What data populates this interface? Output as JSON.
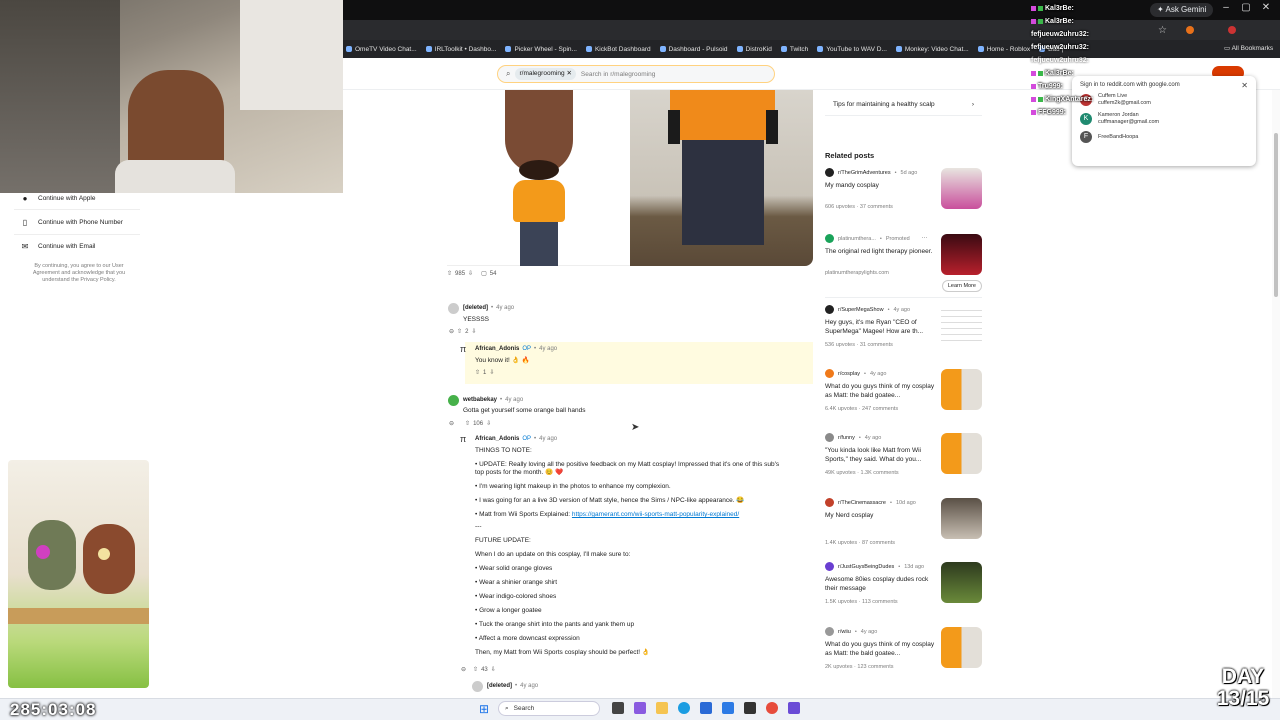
{
  "browser": {
    "ask_gemini": "Ask Gemini",
    "bookmarks": [
      "OmeTV Video Chat...",
      "IRLToolkit • Dashbo...",
      "Picker Wheel - Spin...",
      "KickBot Dashboard",
      "Dashboard - Pulsoid",
      "DistroKid",
      "Twitch",
      "YouTube to WAV D...",
      "Monkey: Video Chat...",
      "Home - Roblox",
      "Bau |"
    ],
    "all_bookmarks": "All Bookmarks"
  },
  "reddit": {
    "search_chip": "r/malegrooming",
    "search_placeholder": "Search in r/malegrooming",
    "post_votes": "985",
    "post_comments": "54"
  },
  "login_panel": {
    "apple": "Continue with Apple",
    "phone": "Continue with Phone Number",
    "email": "Continue with Email",
    "terms": "By continuing, you agree to our User Agreement and acknowledge that you understand the Privacy Policy."
  },
  "comments": {
    "c1_user": "[deleted]",
    "c1_time": "4y ago",
    "c1_text": "YESSSS",
    "c1_votes": "2",
    "c2_user": "African_Adonis",
    "c2_op": "OP",
    "c2_time": "4y ago",
    "c2_text": "You know it! 👌 🔥",
    "c2_votes": "1",
    "c3_user": "wetbabekay",
    "c3_time": "4y ago",
    "c3_text": "Gotta get yourself some orange ball hands",
    "c3_votes": "106",
    "c4_user": "African_Adonis",
    "c4_op": "OP",
    "c4_time": "4y ago",
    "c4_lines": [
      "THINGS TO NOTE:",
      "• UPDATE: Really loving all the positive feedback on my Matt cosplay! Impressed that it's one of this sub's",
      "top posts for the month. 😊 ❤️",
      "• I'm wearing light makeup in the photos to enhance my complexion.",
      "• I was going for an a live 3D version of Matt style, hence the Sims / NPC-like appearance. 😂",
      "• Matt from Wii Sports Explained: ",
      "---",
      "FUTURE UPDATE:",
      "When I do an update on this cosplay, I'll make sure to:",
      "• Wear solid orange gloves",
      "• Wear a shinier orange shirt",
      "• Wear indigo-colored shoes",
      "• Grow a longer goatee",
      "• Tuck the orange shirt into the pants and yank them up",
      "• Affect a more downcast expression",
      "Then, my Matt from Wii Sports cosplay should be perfect! 👌"
    ],
    "c4_link": "https://gamerant.com/wii-sports-matt-popularity-explained/",
    "c4_votes": "43",
    "c5_user": "[deleted]",
    "c5_time": "4y ago"
  },
  "sidebar": {
    "top_item": "Tips for maintaining a healthy scalp",
    "related_header": "Related posts",
    "posts": [
      {
        "sub": "r/TheGrimAdventures",
        "time": "5d ago",
        "title": "My mandy cosplay",
        "stats": "606 upvotes · 37 comments",
        "color": "#e43f8f"
      },
      {
        "sub": "platinumthera...",
        "time": "Promoted",
        "title": "The original red light therapy pioneer.",
        "stats": "platinumtherapylights.com",
        "cta": "Learn More",
        "color": "#1aa35a"
      },
      {
        "sub": "r/SuperMegaShow",
        "time": "4y ago",
        "title": "Hey guys, it's me Ryan \"CEO of SuperMega\" Magee! How are th...",
        "stats": "536 upvotes · 31 comments",
        "color": "#222"
      },
      {
        "sub": "r/cosplay",
        "time": "4y ago",
        "title": "What do you guys think of my cosplay as Matt: the bald goatee...",
        "stats": "6.4K upvotes · 247 comments",
        "color": "#f07a1a"
      },
      {
        "sub": "r/funny",
        "time": "4y ago",
        "title": "\"You kinda look like Matt from Wii Sports,\" they said. What do you...",
        "stats": "49K upvotes · 1.3K comments",
        "color": "#7a7a7a"
      },
      {
        "sub": "r/TheCinemassacre",
        "time": "10d ago",
        "title": "My Nerd cosplay",
        "stats": "1.4K upvotes · 87 comments",
        "color": "#c2412a"
      },
      {
        "sub": "r/JustGuysBeingDudes",
        "time": "13d ago",
        "title": "Awesome 80ies cosplay dudes rock their message",
        "stats": "1.5K upvotes · 113 comments",
        "color": "#6a3fd1"
      },
      {
        "sub": "r/wiiu",
        "time": "4y ago",
        "title": "What do you guys think of my cosplay as Matt: the bald goatee...",
        "stats": "2K upvotes · 123 comments",
        "color": "#999"
      }
    ]
  },
  "google_popup": {
    "title": "Sign in to reddit.com with google.com",
    "accounts": [
      {
        "name": "Cuffem Live",
        "email": "cuffem2k@gmail.com",
        "initial": "C",
        "color": "#b33"
      },
      {
        "name": "Kameron Jordan",
        "email": "cuffmanager@gmail.com",
        "initial": "K",
        "color": "#1f8a70"
      },
      {
        "name": "FreeBandHoopa",
        "email": "",
        "initial": "F",
        "color": "#555"
      }
    ]
  },
  "chat": [
    "Kal3rBe:",
    "Kal3rBe:",
    "fefjueuw2uhru32:",
    "fefjueuw2uhru32:",
    "fefjueuw2uhru32:",
    "Kal3rBe:",
    "Tru999:",
    "KingXAntarez:",
    "FFG999:"
  ],
  "taskbar": {
    "search": "Search"
  },
  "overlay": {
    "timer": "285:03:08",
    "day_label": "DAY",
    "day_value": "13/15"
  }
}
